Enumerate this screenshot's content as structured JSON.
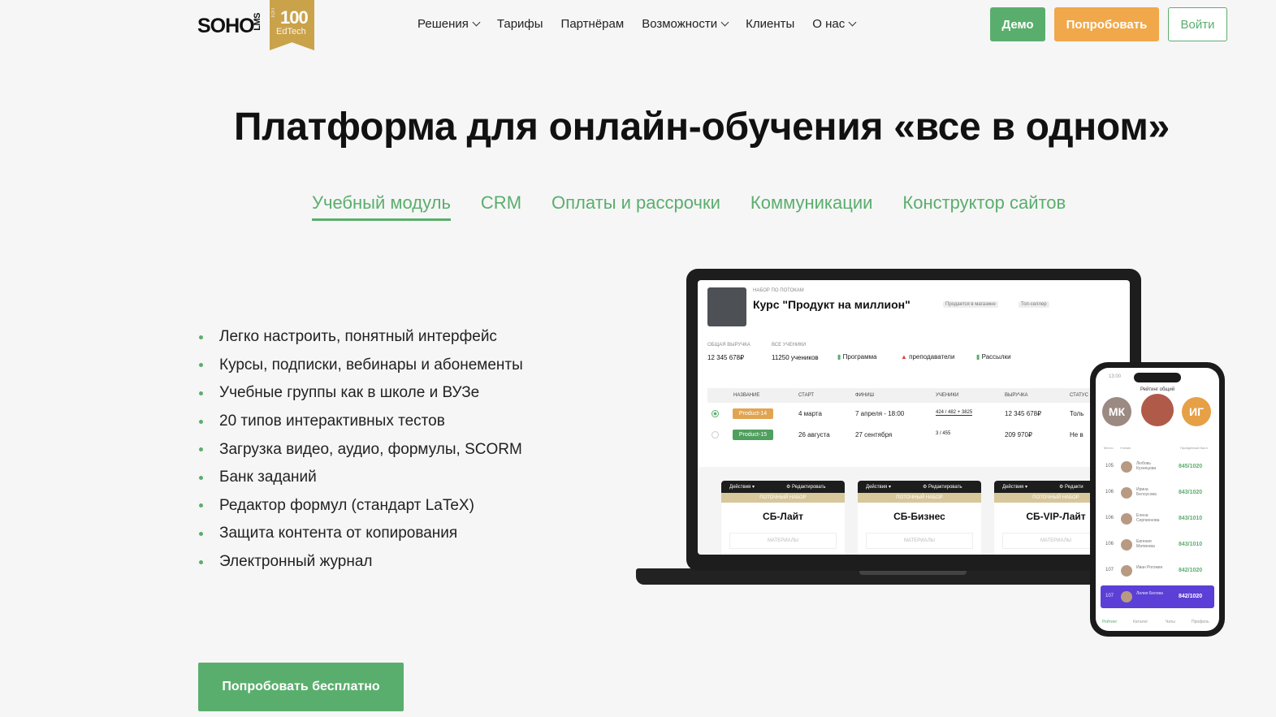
{
  "brand": {
    "logo_part1": "SOHO",
    "logo_part2": "LMS",
    "badge_top": "ТОП",
    "badge_number": "100",
    "badge_label": "EdTech"
  },
  "nav": {
    "items": [
      {
        "label": "Решения"
      },
      {
        "label": "Тарифы"
      },
      {
        "label": "Партнёрам"
      },
      {
        "label": "Возможности"
      },
      {
        "label": "Клиенты"
      },
      {
        "label": "О нас"
      }
    ]
  },
  "header_buttons": {
    "demo": "Демо",
    "try": "Попробовать",
    "login": "Войти"
  },
  "hero": {
    "title": "Платформа для онлайн-обучения «все в одном»"
  },
  "tabs": [
    {
      "label": "Учебный модуль",
      "active": true
    },
    {
      "label": "CRM",
      "active": false
    },
    {
      "label": "Оплаты и рассрочки",
      "active": false
    },
    {
      "label": "Коммуникации",
      "active": false
    },
    {
      "label": "Конструктор сайтов",
      "active": false
    }
  ],
  "features": [
    "Легко настроить, понятный интерфейс",
    "Курсы, подписки, вебинары и абонементы",
    "Учебные группы как в школе и ВУЗе",
    "20 типов интерактивных тестов",
    "Загрузка видео, аудио, формулы, SCORM",
    "Банк заданий",
    "Редактор формул (стандарт LaTeX)",
    "Защита контента от копирования",
    "Электронный журнал"
  ],
  "cta": {
    "label": "Попробовать бесплатно"
  },
  "laptop": {
    "supertitle": "НАБОР ПО ПОТОКАМ",
    "course_title": "Курс \"Продукт на миллион\"",
    "tags": [
      "Продается в магазине",
      "Топ-селлер"
    ],
    "stats": [
      {
        "label": "ОБЩАЯ ВЫРУЧКА",
        "value": "12 345 678₽"
      },
      {
        "label": "ВСЕ УЧЕНИКИ",
        "value": "11250 учеников"
      }
    ],
    "actions": [
      "Программа",
      "преподаватели",
      "Рассылки"
    ],
    "columns": [
      "НАЗВАНИЕ",
      "СТАРТ",
      "ФИНИШ",
      "УЧЕНИКИ",
      "ВЫРУЧКА",
      "СТАТУС"
    ],
    "rows": [
      {
        "name": "Product-14",
        "color": "#e0a553",
        "start": "4 марта",
        "finish": "7 апреля - 18:00",
        "students": "424 / 482 + 3825",
        "revenue": "12 345 678₽",
        "status": "Толь",
        "selected": true
      },
      {
        "name": "Product-15",
        "color": "#4f9f5f",
        "start": "26 августа",
        "finish": "27 сентября",
        "students": "3 / 455",
        "revenue": "209 970₽",
        "status": "Не в",
        "selected": false
      }
    ],
    "cards": [
      {
        "actions": "Действия ▾",
        "edit": "⚙ Редактировать",
        "band": "ПОТОЧНЫЙ НАБОР",
        "name": "СБ-Лайт",
        "sub": "МАТЕРИАЛЫ"
      },
      {
        "actions": "Действия ▾",
        "edit": "⚙ Редактировать",
        "band": "ПОТОЧНЫЙ НАБОР",
        "name": "СБ-Бизнес",
        "sub": "МАТЕРИАЛЫ"
      },
      {
        "actions": "Действия ▾",
        "edit": "⚙ Редакти",
        "band": "ПОТОЧНЫЙ НАБОР",
        "name": "СБ-VIP-Лайт",
        "sub": "МАТЕРИАЛЫ"
      }
    ]
  },
  "phone": {
    "time": "13:00",
    "title": "Рейтинг общий",
    "podium": [
      {
        "initials": "МК"
      },
      {
        "initials": ""
      },
      {
        "initials": "ИГ"
      }
    ],
    "col_place": "Место",
    "col_student": "Ученик",
    "col_score": "Пройденный балл",
    "rows": [
      {
        "place": "105",
        "name": "Любовь Кузнецова",
        "score": "845/1020",
        "highlight": false
      },
      {
        "place": "106",
        "name": "Ирина Белоусова",
        "score": "843/1020",
        "highlight": false
      },
      {
        "place": "106",
        "name": "Елена Серпионова",
        "score": "843/1010",
        "highlight": false
      },
      {
        "place": "106",
        "name": "Евгения Матвеева",
        "score": "843/1010",
        "highlight": false
      },
      {
        "place": "107",
        "name": "Иван Рогожин",
        "score": "842/1020",
        "highlight": false
      },
      {
        "place": "107",
        "name": "Лилия Белова",
        "score": "842/1020",
        "highlight": true
      }
    ],
    "nav": [
      "Рейтинг",
      "Каталог",
      "Чаты",
      "Профиль"
    ]
  }
}
